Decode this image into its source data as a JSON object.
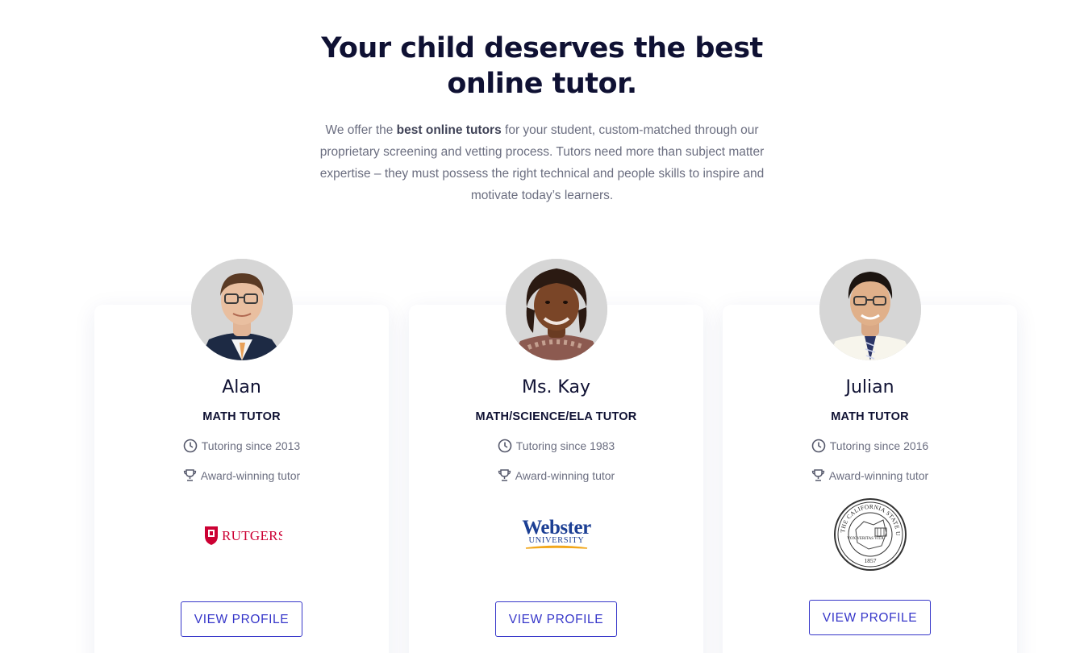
{
  "hero": {
    "title": "Your child deserves the best online tutor.",
    "intro_before": "We offer the ",
    "intro_bold": "best online tutors",
    "intro_after": " for your student, custom-matched through our proprietary screening and vetting process. Tutors need more than subject matter expertise – they must possess the right technical and people skills to inspire and motivate today’s learners."
  },
  "tutors": [
    {
      "name": "Alan",
      "role": "MATH TUTOR",
      "since": "Tutoring since 2013",
      "award": "Award-winning tutor",
      "logo_text": "RUTGERS",
      "logo_color": "#cc0033",
      "button": "VIEW PROFILE"
    },
    {
      "name": "Ms. Kay",
      "role": "MATH/SCIENCE/ELA TUTOR",
      "since": "Tutoring since 1983",
      "award": "Award-winning tutor",
      "logo_text": "Webster",
      "logo_subtext": "UNIVERSITY",
      "logo_color": "#1c3f94",
      "button": "VIEW PROFILE"
    },
    {
      "name": "Julian",
      "role": "MATH TUTOR",
      "since": "Tutoring since 2016",
      "award": "Award-winning tutor",
      "logo_text": "THE CALIFORNIA STATE UNIVERSITY",
      "logo_motto": "VOX VERITAS VITA",
      "logo_year": "1857",
      "button": "VIEW PROFILE"
    }
  ],
  "colors": {
    "heading": "#0f1133",
    "body_text": "#6b6e80",
    "accent": "#3636c9"
  },
  "icons": {
    "since": "clock-icon",
    "award": "trophy-icon"
  }
}
